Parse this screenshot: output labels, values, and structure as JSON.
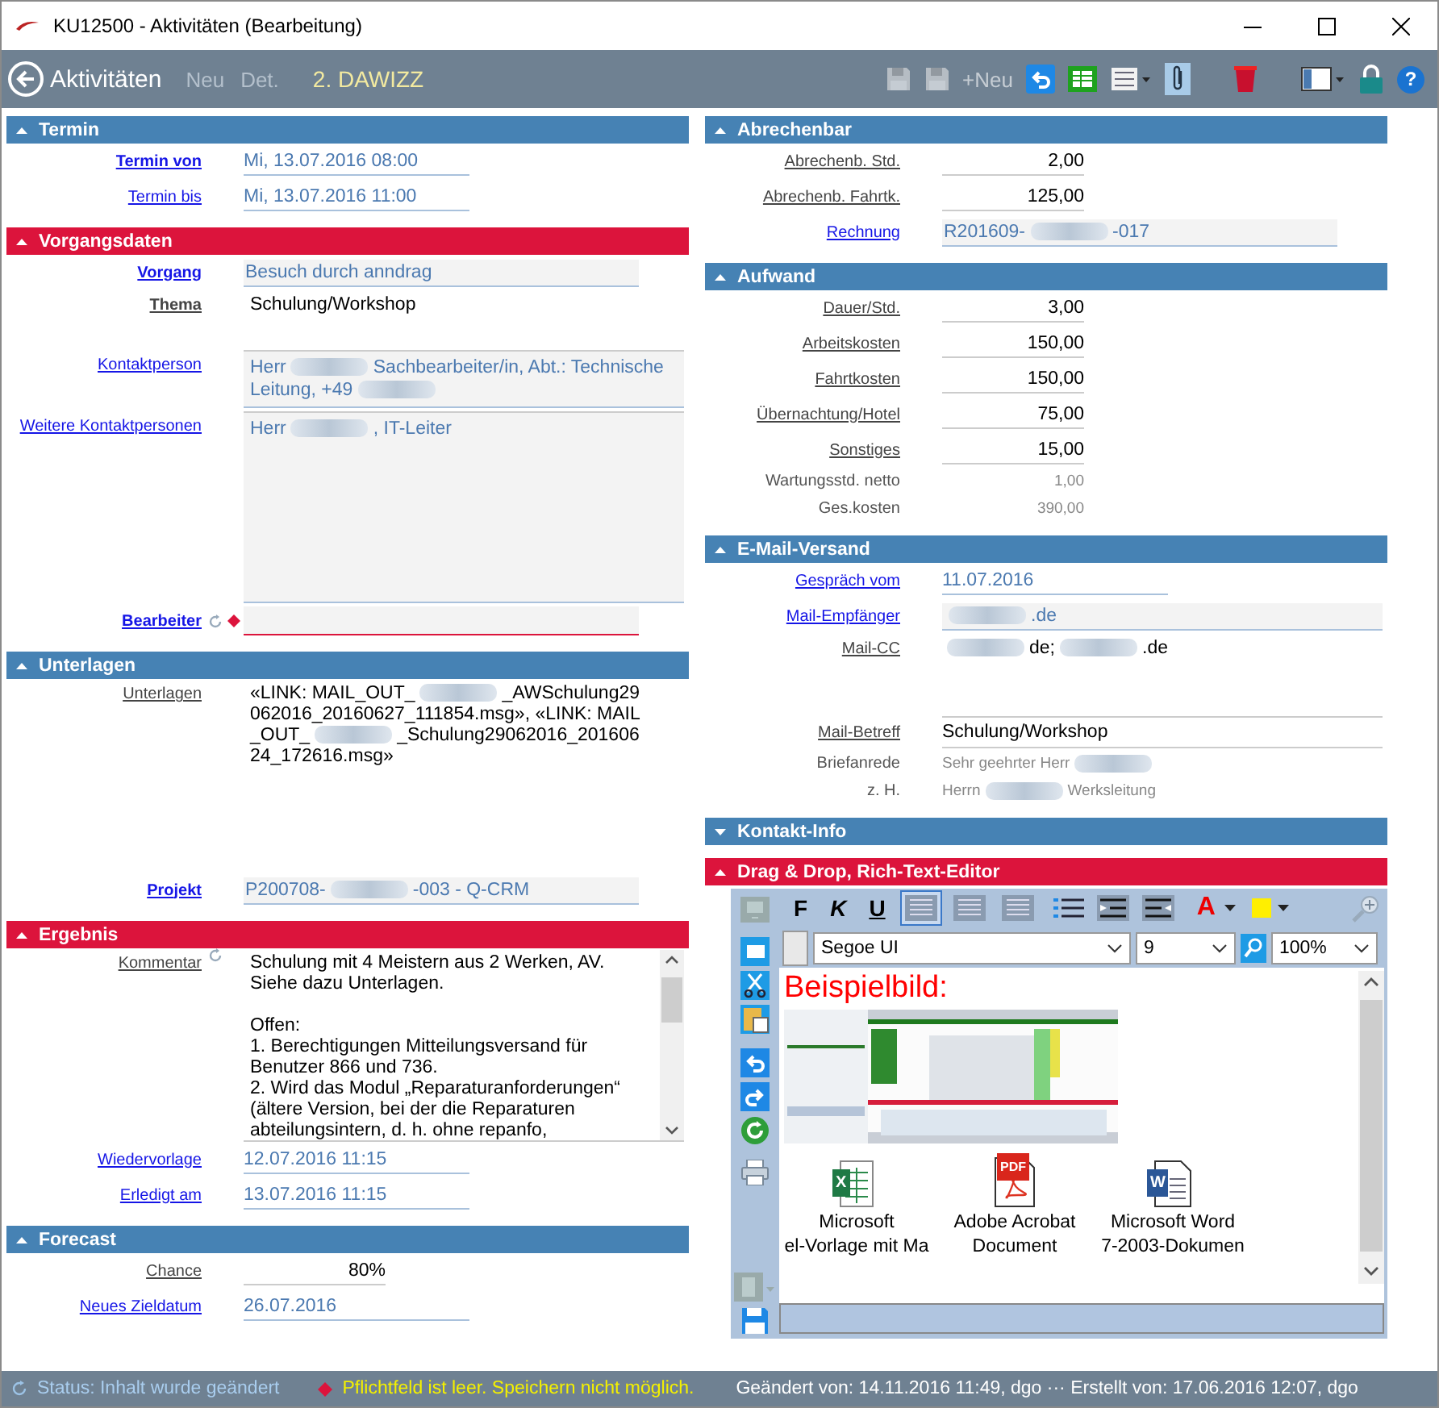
{
  "window": {
    "title": "KU12500 - Aktivitäten (Bearbeitung)"
  },
  "toolbar": {
    "back_label": "Aktivitäten",
    "record": "2. DAWIZZ",
    "actions": [
      {
        "label": "Neu",
        "disabled": true
      },
      {
        "label": "Det.",
        "disabled": true
      }
    ],
    "tools": [
      {
        "kind": "save",
        "disabled": true
      },
      {
        "kind": "save",
        "disabled": true
      },
      {
        "kind": "text",
        "label": "+Neu",
        "disabled": true
      },
      {
        "kind": "undo",
        "disabled": false
      },
      {
        "kind": "sheet",
        "disabled": false
      },
      {
        "kind": "list",
        "disabled": false
      },
      {
        "kind": "attach",
        "disabled": false
      },
      {
        "kind": "delete",
        "disabled": false
      },
      {
        "kind": "layout",
        "disabled": false
      },
      {
        "kind": "lock",
        "disabled": false
      },
      {
        "kind": "help",
        "label": "?",
        "disabled": false
      }
    ]
  },
  "left": [
    {
      "title": "Termin",
      "color": "#4682b4",
      "expanded": true,
      "fields": [
        {
          "label": "Termin von",
          "link": true,
          "bold": true,
          "underlined": true,
          "value": "Mi, 13.07.2016 08:00",
          "kind": "date"
        },
        {
          "label": "Termin bis",
          "link": true,
          "bold": false,
          "underlined": true,
          "value": "Mi, 13.07.2016 11:00",
          "kind": "date"
        }
      ]
    },
    {
      "title": "Vorgangsdaten",
      "color": "#dc143c",
      "expanded": true,
      "fields": [
        {
          "label": "Vorgang",
          "link": true,
          "bold": true,
          "underlined": true,
          "value": "Besuch durch anndrag",
          "kind": "lookup"
        },
        {
          "label": "Thema",
          "link": false,
          "bold": true,
          "underlined": true,
          "value": "Schulung/Workshop",
          "kind": "text"
        },
        {
          "label": "Kontaktperson",
          "link": true,
          "bold": false,
          "underlined": true,
          "kind": "multiline",
          "parts": [
            {
              "kind": "text",
              "text": "Herr"
            },
            {
              "kind": "blurred"
            },
            {
              "kind": "text",
              "text": "Sachbearbeiter/in, Abt.: Technische Leitung, +49"
            },
            {
              "kind": "blurred"
            }
          ]
        },
        {
          "label": "Weitere Kontaktpersonen",
          "link": true,
          "bold": false,
          "underlined": true,
          "kind": "listbox",
          "parts": [
            {
              "kind": "text",
              "text": "Herr"
            },
            {
              "kind": "blurred"
            },
            {
              "kind": "text",
              "text": ", IT-Leiter"
            }
          ]
        },
        {
          "label": "Bearbeiter",
          "link": true,
          "bold": true,
          "underlined": true,
          "reset": true,
          "required": true,
          "kind": "required"
        }
      ]
    },
    {
      "title": "Unterlagen",
      "color": "#4682b4",
      "expanded": true,
      "fields": [
        {
          "label": "Unterlagen",
          "link": false,
          "bold": false,
          "underlined": true,
          "kind": "documents",
          "parts": [
            {
              "kind": "text",
              "text": "«LINK: MAIL_OUT_"
            },
            {
              "kind": "blurred"
            },
            {
              "kind": "text",
              "text": "_AWSchulung29062016_20160627_111854.msg», «LINK: MAIL_OUT_"
            },
            {
              "kind": "blurred"
            },
            {
              "kind": "text",
              "text": "_Schulung29062016_20160624_172616.msg»"
            }
          ]
        },
        {
          "label": "Projekt",
          "link": true,
          "bold": true,
          "underlined": true,
          "kind": "lookup",
          "parts": [
            {
              "kind": "text",
              "text": "P200708-"
            },
            {
              "kind": "blurred"
            },
            {
              "kind": "text",
              "text": "-003 - Q-CRM"
            }
          ]
        }
      ]
    },
    {
      "title": "Ergebnis",
      "color": "#dc143c",
      "expanded": true,
      "fields": [
        {
          "label": "Kommentar",
          "link": false,
          "bold": false,
          "underlined": true,
          "reset": true,
          "kind": "textarea",
          "value": "Schulung mit 4 Meistern aus 2 Werken, AV.\nSiehe dazu Unterlagen.\n\nOffen:\n1. Berechtigungen Mitteilungsversand für Benutzer 866 und 736.\n2. Wird das Modul „Reparaturanforderungen“ (ältere Version, bei der die Reparaturen abteilungsintern, d. h. ohne repanfo,"
        },
        {
          "label": "Wiedervorlage",
          "link": true,
          "bold": false,
          "underlined": true,
          "value": "12.07.2016 11:15",
          "kind": "date"
        },
        {
          "label": "Erledigt am",
          "link": true,
          "bold": false,
          "underlined": true,
          "value": "13.07.2016 11:15",
          "kind": "date"
        }
      ]
    },
    {
      "title": "Forecast",
      "color": "#4682b4",
      "expanded": true,
      "fields": [
        {
          "label": "Chance",
          "link": false,
          "bold": false,
          "underlined": true,
          "value": "80%",
          "kind": "number"
        },
        {
          "label": "Neues Zieldatum",
          "link": true,
          "bold": false,
          "underlined": true,
          "value": "26.07.2016",
          "kind": "date"
        }
      ]
    }
  ],
  "right": [
    {
      "title": "Abrechenbar",
      "color": "#4682b4",
      "expanded": true,
      "fields": [
        {
          "label": "Abrechenb. Std.",
          "link": false,
          "bold": false,
          "underlined": true,
          "value": "2,00",
          "kind": "number"
        },
        {
          "label": "Abrechenb. Fahrtk.",
          "link": false,
          "bold": false,
          "underlined": true,
          "value": "125,00",
          "kind": "number"
        },
        {
          "label": "Rechnung",
          "link": true,
          "bold": false,
          "underlined": true,
          "kind": "lookup",
          "parts": [
            {
              "kind": "text",
              "text": "R201609-"
            },
            {
              "kind": "blurred"
            },
            {
              "kind": "text",
              "text": "-017"
            }
          ]
        }
      ]
    },
    {
      "title": "Aufwand",
      "color": "#4682b4",
      "expanded": true,
      "fields": [
        {
          "label": "Dauer/Std.",
          "link": false,
          "bold": false,
          "underlined": true,
          "value": "3,00",
          "kind": "number"
        },
        {
          "label": "Arbeitskosten",
          "link": false,
          "bold": false,
          "underlined": true,
          "value": "150,00",
          "kind": "number"
        },
        {
          "label": "Fahrtkosten",
          "link": false,
          "bold": false,
          "underlined": true,
          "value": "150,00",
          "kind": "number"
        },
        {
          "label": "Übernachtung/Hotel",
          "link": false,
          "bold": false,
          "underlined": true,
          "value": "75,00",
          "kind": "number"
        },
        {
          "label": "Sonstiges",
          "link": false,
          "bold": false,
          "underlined": true,
          "value": "15,00",
          "kind": "number"
        },
        {
          "label": "Wartungsstd. netto",
          "link": false,
          "bold": false,
          "underlined": false,
          "value": "1,00",
          "kind": "mutednum"
        },
        {
          "label": "Ges.kosten",
          "link": false,
          "bold": false,
          "underlined": false,
          "value": "390,00",
          "kind": "mutednum"
        }
      ]
    },
    {
      "title": "E-Mail-Versand",
      "color": "#4682b4",
      "expanded": true,
      "fields": [
        {
          "label": "Gespräch vom",
          "link": true,
          "bold": false,
          "underlined": true,
          "value": "11.07.2016",
          "kind": "date"
        },
        {
          "label": "Mail-Empfänger",
          "link": true,
          "bold": false,
          "underlined": true,
          "kind": "wide",
          "parts": [
            {
              "kind": "blurred"
            },
            {
              "kind": "text",
              "text": ".de"
            }
          ]
        },
        {
          "label": "Mail-CC",
          "link": false,
          "bold": false,
          "underlined": true,
          "kind": "cc",
          "parts": [
            {
              "kind": "blurred"
            },
            {
              "kind": "text",
              "text": "de;"
            },
            {
              "kind": "blurred"
            },
            {
              "kind": "text",
              "text": ".de"
            }
          ]
        },
        {
          "label": "Mail-Betreff",
          "link": false,
          "bold": false,
          "underlined": true,
          "value": "Schulung/Workshop",
          "kind": "subject"
        },
        {
          "label": "Briefanrede",
          "link": false,
          "bold": false,
          "underlined": false,
          "kind": "muted",
          "parts": [
            {
              "kind": "text",
              "text": "Sehr geehrter Herr"
            },
            {
              "kind": "blurred"
            }
          ]
        },
        {
          "label": "z. H.",
          "link": false,
          "bold": false,
          "underlined": false,
          "kind": "muted",
          "parts": [
            {
              "kind": "text",
              "text": "Herrn"
            },
            {
              "kind": "blurred"
            },
            {
              "kind": "text",
              "text": "Werksleitung"
            }
          ]
        }
      ]
    },
    {
      "title": "Kontakt-Info",
      "color": "#4682b4",
      "expanded": false
    },
    {
      "title": "Drag & Drop, Rich-Text-Editor",
      "color": "#dc143c",
      "expanded": true,
      "editor": {
        "format_buttons": [
          {
            "label": "F",
            "kind": "bold"
          },
          {
            "label": "K",
            "kind": "italic"
          },
          {
            "label": "U",
            "kind": "underline"
          }
        ],
        "align_buttons": [
          {
            "selected": true
          },
          {
            "selected": false
          },
          {
            "selected": false
          }
        ],
        "font_color_label": "A",
        "font": "Segoe UI",
        "size": "9",
        "zoom": "100%",
        "heading": "Beispielbild:",
        "attachments": [
          {
            "kind": "excel",
            "icon_text": "X",
            "lines": [
              "Microsoft",
              "el-Vorlage mit Ma"
            ]
          },
          {
            "kind": "pdf",
            "icon_text": "PDF",
            "lines": [
              "Adobe Acrobat",
              "Document"
            ]
          },
          {
            "kind": "word",
            "icon_text": "W",
            "lines": [
              "Microsoft Word",
              "7-2003-Dokumen"
            ]
          }
        ]
      }
    }
  ],
  "status_bar": {
    "status": "Status: Inhalt wurde geändert",
    "warning": "Pflichtfeld ist leer. Speichern nicht möglich.",
    "info": "Geändert von: 14.11.2016 11:49, dgo ··· Erstellt von: 17.06.2016 12:07, dgo"
  }
}
